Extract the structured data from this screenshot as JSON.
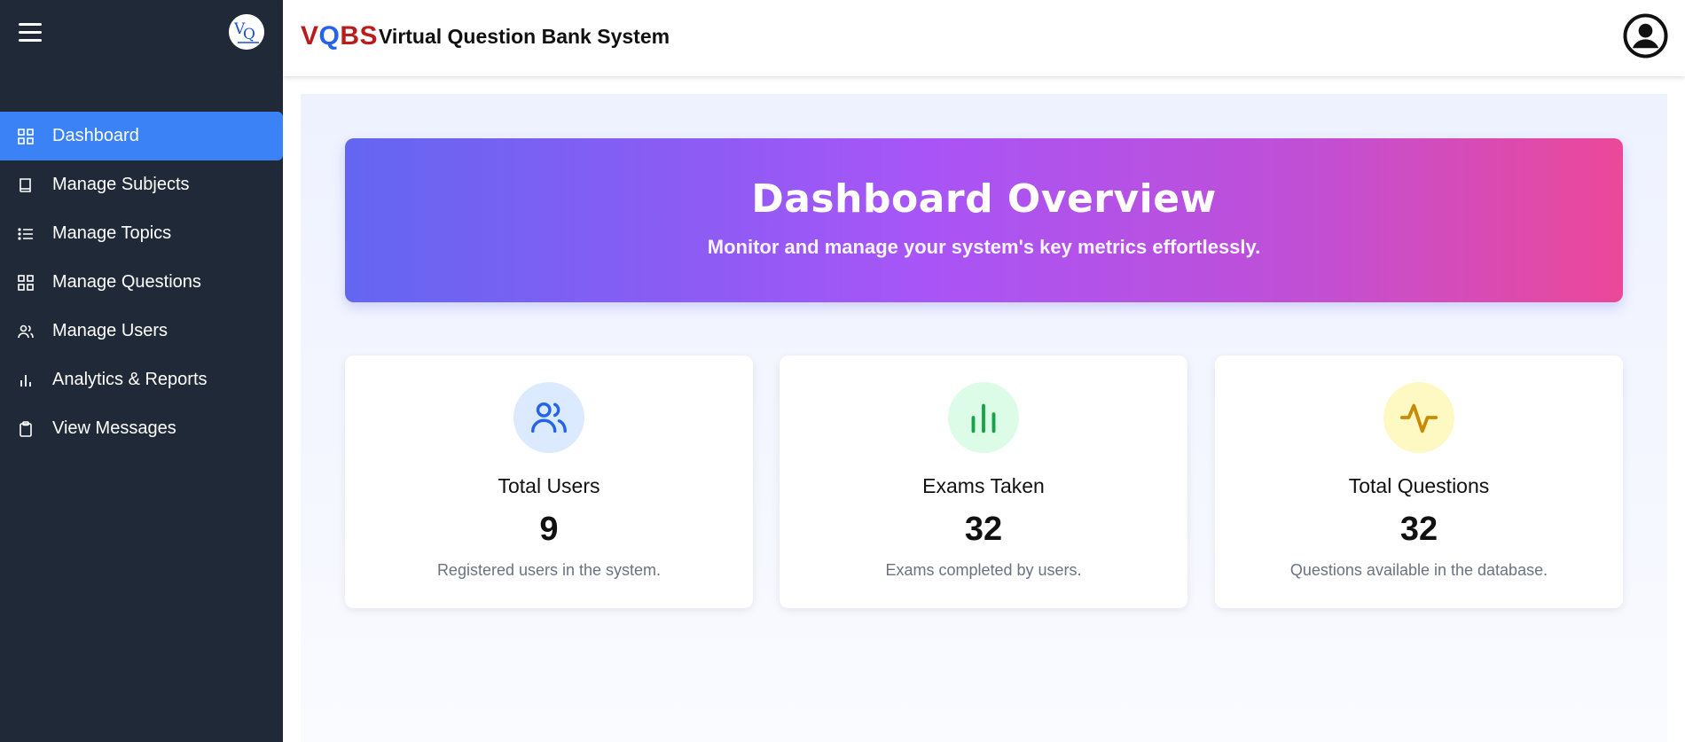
{
  "brand": {
    "v": "V",
    "q": "Q",
    "bs": "BS",
    "app_title": "Virtual Question Bank System"
  },
  "sidebar": {
    "items": [
      {
        "label": "Dashboard",
        "icon": "grid-icon",
        "active": true
      },
      {
        "label": "Manage Subjects",
        "icon": "book-icon",
        "active": false
      },
      {
        "label": "Manage Topics",
        "icon": "list-icon",
        "active": false
      },
      {
        "label": "Manage Questions",
        "icon": "grid-icon",
        "active": false
      },
      {
        "label": "Manage Users",
        "icon": "users-icon",
        "active": false
      },
      {
        "label": "Analytics & Reports",
        "icon": "bar-chart-icon",
        "active": false
      },
      {
        "label": "View Messages",
        "icon": "clipboard-icon",
        "active": false
      }
    ]
  },
  "hero": {
    "title": "Dashboard Overview",
    "subtitle": "Monitor and manage your system's key metrics effortlessly."
  },
  "cards": [
    {
      "label": "Total Users",
      "value": "9",
      "desc": "Registered users in the system.",
      "icon": "users-icon",
      "bg": "#dbeafe",
      "color": "#2563eb"
    },
    {
      "label": "Exams Taken",
      "value": "32",
      "desc": "Exams completed by users.",
      "icon": "bar-chart-icon",
      "bg": "#dcfce7",
      "color": "#16a34a"
    },
    {
      "label": "Total Questions",
      "value": "32",
      "desc": "Questions available in the database.",
      "icon": "activity-icon",
      "bg": "#fef9c3",
      "color": "#ca8a04"
    }
  ],
  "colors": {
    "sidebar_bg": "#1f2937",
    "active_bg": "#3b82f6"
  }
}
